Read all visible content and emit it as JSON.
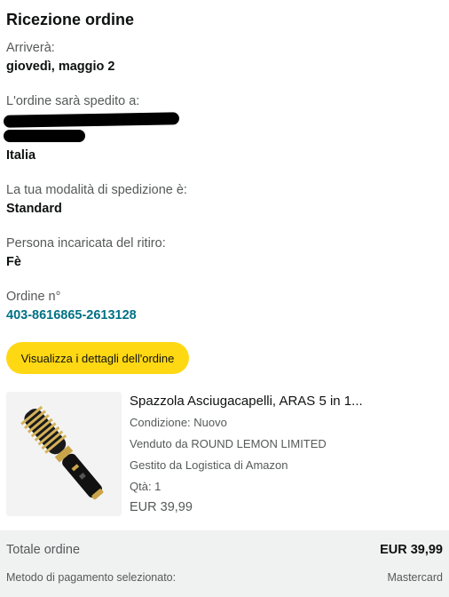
{
  "header": {
    "title": "Ricezione ordine"
  },
  "arrival": {
    "label": "Arriverà:",
    "date": "giovedì, maggio 2"
  },
  "shipping": {
    "label": "L'ordine sarà spedito a:",
    "country": "Italia"
  },
  "shipping_method": {
    "label": "La tua modalità di spedizione è:",
    "value": "Standard"
  },
  "pickup": {
    "label": "Persona incaricata del ritiro:",
    "name": "Fè"
  },
  "order": {
    "label": "Ordine n°",
    "number": "403-8616865-2613128"
  },
  "actions": {
    "details_button": "Visualizza i dettagli dell'ordine"
  },
  "product": {
    "title": "Spazzola Asciugacapelli, ARAS 5 in 1...",
    "condition": "Condizione: Nuovo",
    "seller": "Venduto da ROUND LEMON LIMITED",
    "fulfilled": "Gestito da Logistica di Amazon",
    "qty": "Qtà: 1",
    "price": "EUR 39,99"
  },
  "summary": {
    "total_label": "Totale ordine",
    "total_value": "EUR 39,99",
    "payment_label": "Metodo di pagamento selezionato:",
    "payment_value": "Mastercard"
  },
  "colors": {
    "button": "#ffd814",
    "link": "#007185",
    "footer_bg": "#f0f2f2"
  }
}
